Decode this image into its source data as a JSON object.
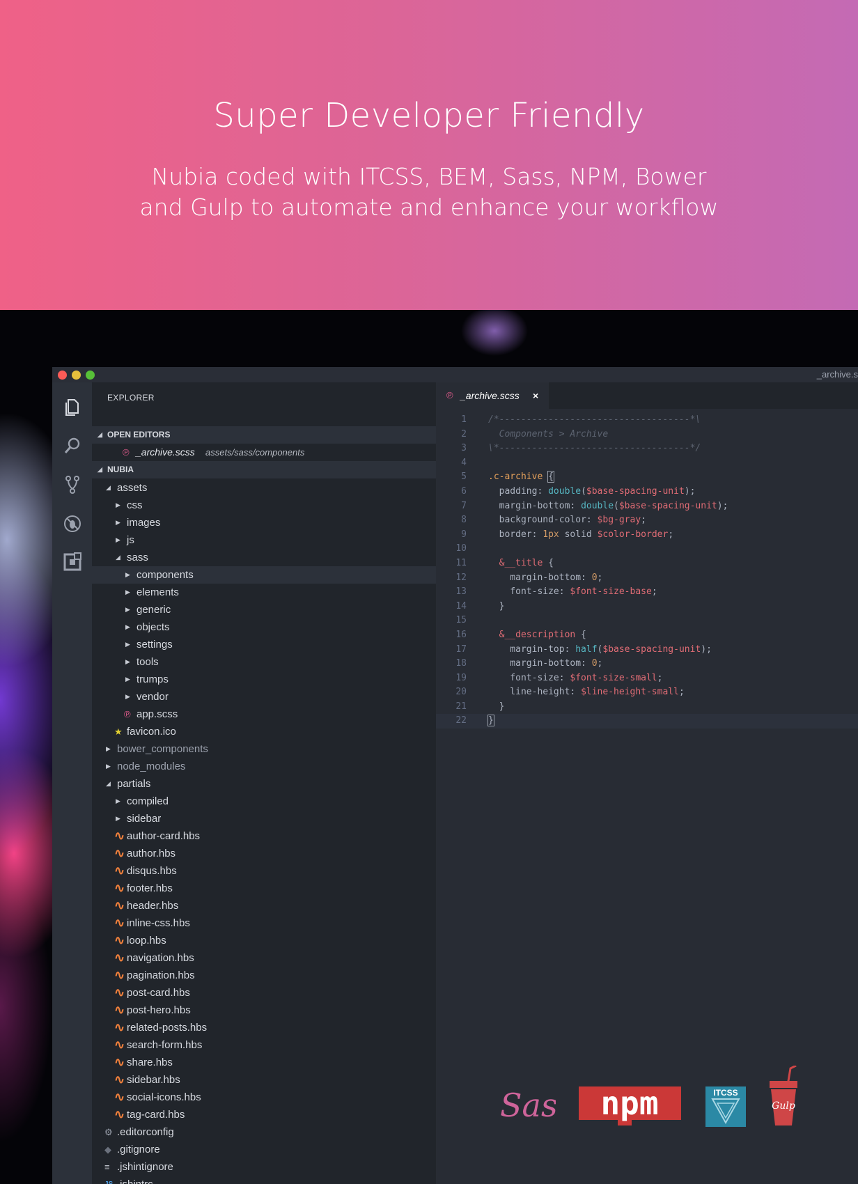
{
  "hero": {
    "title": "Super Developer Friendly",
    "subtitle_line1": "Nubia coded with ITCSS, BEM, Sass, NPM, Bower",
    "subtitle_line2": "and Gulp to automate and enhance your workflow"
  },
  "window": {
    "title": "_archive.s"
  },
  "activity_bar": [
    {
      "icon": "files-icon"
    },
    {
      "icon": "search-icon"
    },
    {
      "icon": "source-control-icon"
    },
    {
      "icon": "debug-icon"
    },
    {
      "icon": "extensions-icon"
    }
  ],
  "sidebar": {
    "title": "EXPLORER",
    "open_editors_label": "OPEN EDITORS",
    "open_editor": {
      "name": "_archive.scss",
      "path": "assets/sass/components"
    },
    "project_label": "NUBIA",
    "tree": [
      {
        "label": "assets",
        "depth": 1,
        "kind": "folder-open"
      },
      {
        "label": "css",
        "depth": 2,
        "kind": "folder"
      },
      {
        "label": "images",
        "depth": 2,
        "kind": "folder"
      },
      {
        "label": "js",
        "depth": 2,
        "kind": "folder"
      },
      {
        "label": "sass",
        "depth": 2,
        "kind": "folder-open"
      },
      {
        "label": "components",
        "depth": 3,
        "kind": "folder",
        "selected": true
      },
      {
        "label": "elements",
        "depth": 3,
        "kind": "folder"
      },
      {
        "label": "generic",
        "depth": 3,
        "kind": "folder"
      },
      {
        "label": "objects",
        "depth": 3,
        "kind": "folder"
      },
      {
        "label": "settings",
        "depth": 3,
        "kind": "folder"
      },
      {
        "label": "tools",
        "depth": 3,
        "kind": "folder"
      },
      {
        "label": "trumps",
        "depth": 3,
        "kind": "folder"
      },
      {
        "label": "vendor",
        "depth": 3,
        "kind": "folder"
      },
      {
        "label": "app.scss",
        "depth": 3,
        "kind": "sass-file"
      },
      {
        "label": "favicon.ico",
        "depth": 2,
        "kind": "star-file"
      },
      {
        "label": "bower_components",
        "depth": 1,
        "kind": "folder"
      },
      {
        "label": "node_modules",
        "depth": 1,
        "kind": "folder"
      },
      {
        "label": "partials",
        "depth": 1,
        "kind": "folder-open"
      },
      {
        "label": "compiled",
        "depth": 2,
        "kind": "folder"
      },
      {
        "label": "sidebar",
        "depth": 2,
        "kind": "folder"
      },
      {
        "label": "author-card.hbs",
        "depth": 2,
        "kind": "hbs-file"
      },
      {
        "label": "author.hbs",
        "depth": 2,
        "kind": "hbs-file"
      },
      {
        "label": "disqus.hbs",
        "depth": 2,
        "kind": "hbs-file"
      },
      {
        "label": "footer.hbs",
        "depth": 2,
        "kind": "hbs-file"
      },
      {
        "label": "header.hbs",
        "depth": 2,
        "kind": "hbs-file"
      },
      {
        "label": "inline-css.hbs",
        "depth": 2,
        "kind": "hbs-file"
      },
      {
        "label": "loop.hbs",
        "depth": 2,
        "kind": "hbs-file"
      },
      {
        "label": "navigation.hbs",
        "depth": 2,
        "kind": "hbs-file"
      },
      {
        "label": "pagination.hbs",
        "depth": 2,
        "kind": "hbs-file"
      },
      {
        "label": "post-card.hbs",
        "depth": 2,
        "kind": "hbs-file"
      },
      {
        "label": "post-hero.hbs",
        "depth": 2,
        "kind": "hbs-file"
      },
      {
        "label": "related-posts.hbs",
        "depth": 2,
        "kind": "hbs-file"
      },
      {
        "label": "search-form.hbs",
        "depth": 2,
        "kind": "hbs-file"
      },
      {
        "label": "share.hbs",
        "depth": 2,
        "kind": "hbs-file"
      },
      {
        "label": "sidebar.hbs",
        "depth": 2,
        "kind": "hbs-file"
      },
      {
        "label": "social-icons.hbs",
        "depth": 2,
        "kind": "hbs-file"
      },
      {
        "label": "tag-card.hbs",
        "depth": 2,
        "kind": "hbs-file"
      },
      {
        "label": ".editorconfig",
        "depth": 1,
        "kind": "gear-file"
      },
      {
        "label": ".gitignore",
        "depth": 1,
        "kind": "git-file"
      },
      {
        "label": ".jshintignore",
        "depth": 1,
        "kind": "lines-file"
      },
      {
        "label": ".jshintrc",
        "depth": 1,
        "kind": "js-file"
      }
    ]
  },
  "editor": {
    "tab": {
      "name": "_archive.scss",
      "close": "×"
    },
    "current_line": 22,
    "lines": [
      [
        {
          "t": "/*-----------------------------------*\\",
          "c": "comment"
        }
      ],
      [
        {
          "t": "  Components > Archive",
          "c": "comment"
        }
      ],
      [
        {
          "t": "\\*-----------------------------------*/",
          "c": "comment"
        }
      ],
      [],
      [
        {
          "t": ".c-archive ",
          "c": "sel"
        },
        {
          "t": "{",
          "c": "bracket"
        }
      ],
      [
        {
          "t": "  padding: ",
          "c": "prop"
        },
        {
          "t": "double",
          "c": "fn"
        },
        {
          "t": "(",
          "c": "prop"
        },
        {
          "t": "$base-spacing-unit",
          "c": "var"
        },
        {
          "t": ");",
          "c": "prop"
        }
      ],
      [
        {
          "t": "  margin-bottom: ",
          "c": "prop"
        },
        {
          "t": "double",
          "c": "fn"
        },
        {
          "t": "(",
          "c": "prop"
        },
        {
          "t": "$base-spacing-unit",
          "c": "var"
        },
        {
          "t": ");",
          "c": "prop"
        }
      ],
      [
        {
          "t": "  background-color: ",
          "c": "prop"
        },
        {
          "t": "$bg-gray",
          "c": "var"
        },
        {
          "t": ";",
          "c": "prop"
        }
      ],
      [
        {
          "t": "  border: ",
          "c": "prop"
        },
        {
          "t": "1px",
          "c": "num"
        },
        {
          "t": " solid ",
          "c": "prop"
        },
        {
          "t": "$color-border",
          "c": "var"
        },
        {
          "t": ";",
          "c": "prop"
        }
      ],
      [],
      [
        {
          "t": "  &__title",
          "c": "amp"
        },
        {
          "t": " {",
          "c": "prop"
        }
      ],
      [
        {
          "t": "    margin-bottom: ",
          "c": "prop"
        },
        {
          "t": "0",
          "c": "num"
        },
        {
          "t": ";",
          "c": "prop"
        }
      ],
      [
        {
          "t": "    font-size: ",
          "c": "prop"
        },
        {
          "t": "$font-size-base",
          "c": "var"
        },
        {
          "t": ";",
          "c": "prop"
        }
      ],
      [
        {
          "t": "  }",
          "c": "prop"
        }
      ],
      [],
      [
        {
          "t": "  &__description",
          "c": "amp"
        },
        {
          "t": " {",
          "c": "prop"
        }
      ],
      [
        {
          "t": "    margin-top: ",
          "c": "prop"
        },
        {
          "t": "half",
          "c": "fn"
        },
        {
          "t": "(",
          "c": "prop"
        },
        {
          "t": "$base-spacing-unit",
          "c": "var"
        },
        {
          "t": ");",
          "c": "prop"
        }
      ],
      [
        {
          "t": "    margin-bottom: ",
          "c": "prop"
        },
        {
          "t": "0",
          "c": "num"
        },
        {
          "t": ";",
          "c": "prop"
        }
      ],
      [
        {
          "t": "    font-size: ",
          "c": "prop"
        },
        {
          "t": "$font-size-small",
          "c": "var"
        },
        {
          "t": ";",
          "c": "prop"
        }
      ],
      [
        {
          "t": "    line-height: ",
          "c": "prop"
        },
        {
          "t": "$line-height-small",
          "c": "var"
        },
        {
          "t": ";",
          "c": "prop"
        }
      ],
      [
        {
          "t": "  }",
          "c": "prop"
        }
      ],
      [
        {
          "t": "}",
          "c": "bracket"
        }
      ]
    ]
  },
  "logos": {
    "sass": "Sass",
    "npm": "npm",
    "itcss": "ITCSS",
    "gulp": "Gulp"
  },
  "colors": {
    "hero_start": "#ef6187",
    "hero_end": "#c46ab4",
    "sass_pink": "#cf649a",
    "npm_red": "#cb3837",
    "itcss_blue": "#2b89a5",
    "gulp_red": "#cf4647",
    "hbs_orange": "#f0803c"
  }
}
